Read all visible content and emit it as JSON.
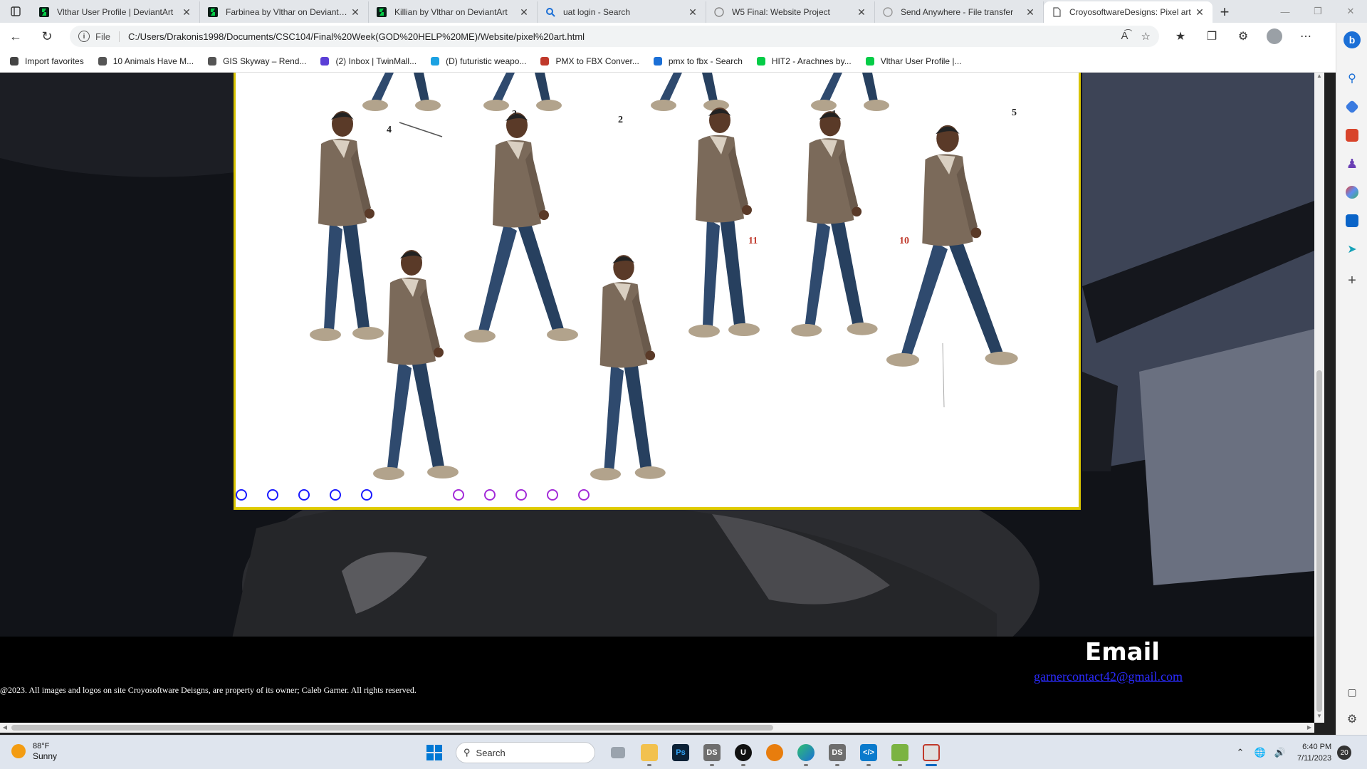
{
  "browser": {
    "tabs": [
      {
        "title": "Vlthar User Profile | DeviantArt",
        "favicon": "deviantart-icon",
        "active": false
      },
      {
        "title": "Farbinea by Vlthar on DeviantArt",
        "favicon": "deviantart-icon",
        "active": false
      },
      {
        "title": "Killian by Vlthar on DeviantArt",
        "favicon": "deviantart-icon",
        "active": false
      },
      {
        "title": "uat login - Search",
        "favicon": "search-icon",
        "active": false
      },
      {
        "title": "W5 Final: Website Project",
        "favicon": "canvas-icon",
        "active": false
      },
      {
        "title": "Send Anywhere - File transfer",
        "favicon": "send-anywhere-icon",
        "active": false
      },
      {
        "title": "CroyosoftwareDesigns: Pixel art",
        "favicon": "file-icon",
        "active": true
      }
    ],
    "new_tab": "+",
    "address": {
      "scheme": "File",
      "url": "C:/Users/Drakonis1998/Documents/CSC104/Final%20Week(GOD%20HELP%20ME)/Website/pixel%20art.html"
    },
    "favorites": [
      {
        "label": "Import favorites",
        "icon": "import-icon"
      },
      {
        "label": "10 Animals Have M...",
        "icon": "news-icon"
      },
      {
        "label": "GIS Skyway – Rend...",
        "icon": "cube-icon"
      },
      {
        "label": "(2) Inbox | TwinMall...",
        "icon": "mail-icon"
      },
      {
        "label": "(D) futuristic weapo...",
        "icon": "disk-icon"
      },
      {
        "label": "PMX to FBX Conver...",
        "icon": "pmx-icon"
      },
      {
        "label": "pmx to fbx - Search",
        "icon": "bing-icon"
      },
      {
        "label": "HIT2 - Arachnes by...",
        "icon": "deviantart-icon"
      },
      {
        "label": "Vlthar User Profile |...",
        "icon": "deviantart-icon"
      }
    ]
  },
  "page": {
    "footer": {
      "copyright": "@2023. All images and logos on site Croyosoftware Deisgns, are property of its owner; Caleb Garner. All rights reserved.",
      "email_title": "Email",
      "email_address": "garnercontact42@gmail.com"
    },
    "sprite_numbers": [
      "4",
      "3",
      "2",
      "1",
      "5",
      "10",
      "11"
    ],
    "dots_blue_count": 5,
    "dots_purple_count": 5
  },
  "taskbar": {
    "weather_temp": "88°F",
    "weather_cond": "Sunny",
    "search_placeholder": "Search",
    "apps": [
      "file-explorer",
      "photoshop",
      "ds",
      "unreal-engine",
      "blender",
      "edge",
      "ds",
      "vscode",
      "notepadpp",
      "snip-tool"
    ],
    "time": "6:40 PM",
    "date": "7/11/2023",
    "notifications": "20"
  },
  "colors": {
    "gallery_border": "#d8c400",
    "dot_blue": "#1a1aff",
    "dot_purple": "#a32bd8",
    "jacket": "#7b6a5a",
    "jeans": "#2f4a6e",
    "link": "#2b2bff"
  }
}
